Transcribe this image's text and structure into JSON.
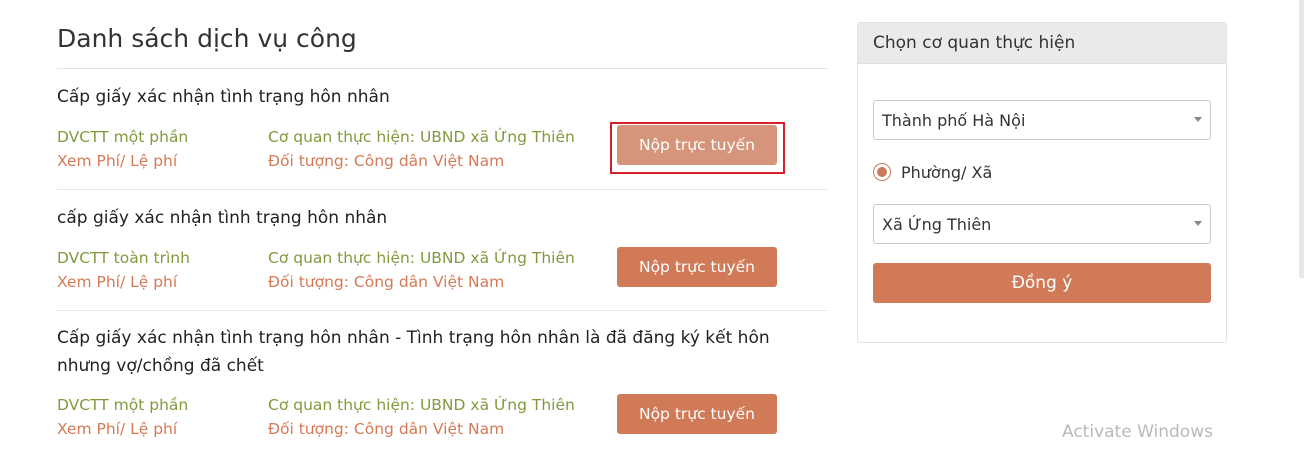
{
  "page_title": "Danh sách dịch vụ công",
  "services": [
    {
      "name": "Cấp giấy xác nhận tình trạng hôn nhân",
      "level": "DVCTT một phần",
      "fee_link": "Xem Phí/ Lệ phí",
      "agency": "Cơ quan thực hiện: UBND xã Ứng Thiên",
      "audience": "Đối tượng: Công dân Việt Nam",
      "submit_label": "Nộp trực tuyến"
    },
    {
      "name": "cấp giấy xác nhận tình trạng hôn nhân",
      "level": "DVCTT toàn trình",
      "fee_link": "Xem Phí/ Lệ phí",
      "agency": "Cơ quan thực hiện: UBND xã Ứng Thiên",
      "audience": "Đối tượng: Công dân Việt Nam",
      "submit_label": "Nộp trực tuyến"
    },
    {
      "name": "Cấp giấy xác nhận tình trạng hôn nhân - Tình trạng hôn nhân là đã đăng ký kết hôn nhưng vợ/chồng đã chết",
      "level": "DVCTT một phần",
      "fee_link": "Xem Phí/ Lệ phí",
      "agency": "Cơ quan thực hiện: UBND xã Ứng Thiên",
      "audience": "Đối tượng: Công dân Việt Nam",
      "submit_label": "Nộp trực tuyến"
    }
  ],
  "panel": {
    "title": "Chọn cơ quan thực hiện",
    "province_value": "Thành phố Hà Nội",
    "radio_label": "Phường/ Xã",
    "radio_checked": true,
    "ward_value": "Xã Ứng Thiên",
    "agree_label": "Đồng ý"
  },
  "watermark": "Activate Windows",
  "colors": {
    "accent": "#d07a58",
    "level_green": "#7f9b3d",
    "fee_orange": "#d57a56",
    "highlight_red": "#d6202a"
  },
  "icons": {
    "dropdown": "chevron-down-icon",
    "radio": "radio-checked-icon"
  }
}
